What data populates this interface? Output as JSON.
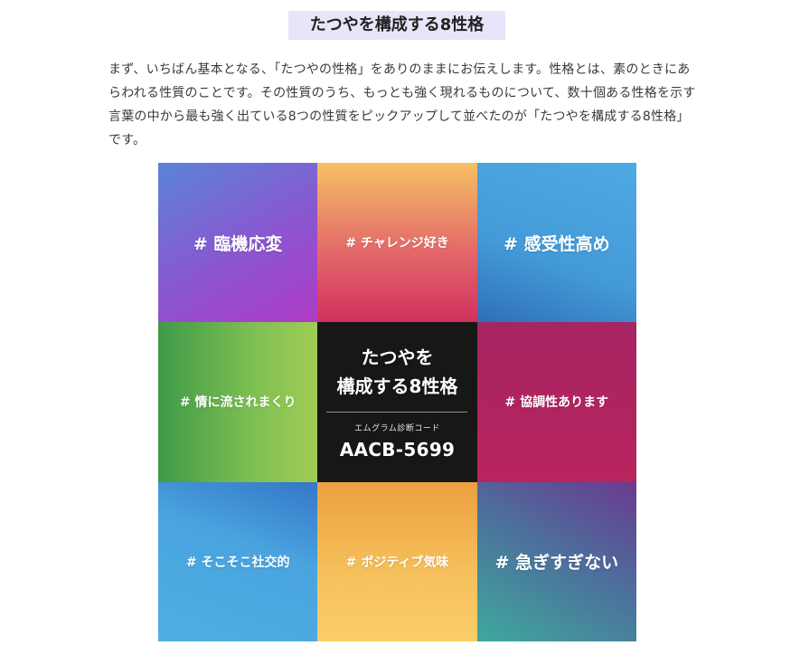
{
  "heading": "たつやを構成する8性格",
  "intro": "まず、いちばん基本となる、「たつやの性格」をありのままにお伝えします。性格とは、素のときにあらわれる性質のことです。その性質のうち、もっとも強く現れるものについて、数十個ある性格を示す言葉の中から最も強く出ている8つの性質をピックアップして並べたのが「たつやを構成する8性格」です。",
  "grid": {
    "tiles": [
      {
        "label": "# 臨機応変"
      },
      {
        "label": "# チャレンジ好き"
      },
      {
        "label": "# 感受性高め"
      },
      {
        "label": "# 情に流されまくり"
      },
      {
        "title_line1": "たつやを",
        "title_line2": "構成する8性格",
        "sub": "エムグラム診断コード",
        "code": "AACB-5699"
      },
      {
        "label": "# 協調性あります"
      },
      {
        "label": "# そこそこ社交的"
      },
      {
        "label": "# ポジティブ気味"
      },
      {
        "label": "# 急ぎすぎない"
      }
    ]
  },
  "colors": {
    "heading_bg": "#e6e6f8",
    "center_bg": "#171717"
  }
}
